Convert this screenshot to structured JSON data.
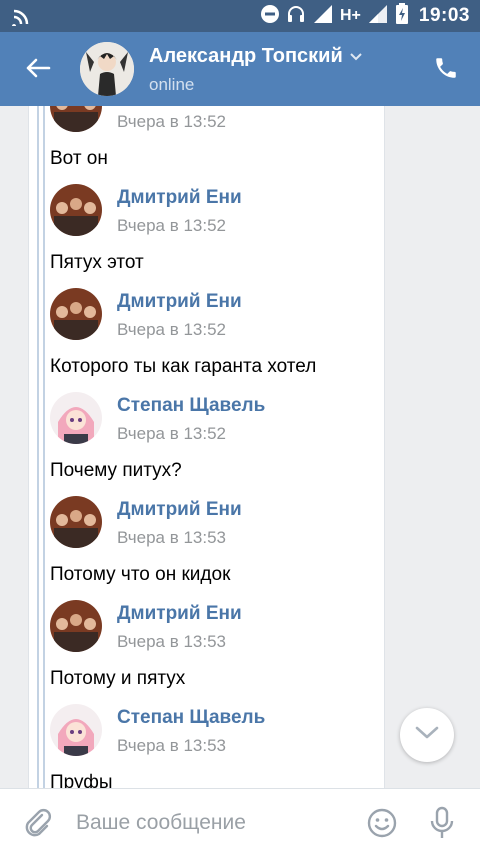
{
  "status_bar": {
    "network": "H+",
    "time": "19:03",
    "icons": [
      "cast-icon",
      "dnd-icon",
      "headphones-icon",
      "signal-icon",
      "signal-icon-2",
      "battery-charging-icon"
    ]
  },
  "header": {
    "back_icon": "arrow-back-icon",
    "contact_name": "Александр Топский",
    "status": "online",
    "call_icon": "phone-icon"
  },
  "messages": [
    {
      "author": "",
      "time": "Вчера в 13:52",
      "text": "Вот он",
      "avatar": "group-photo"
    },
    {
      "author": "Дмитрий Ени",
      "time": "Вчера в 13:52",
      "text": "Пятух этот",
      "avatar": "group-photo"
    },
    {
      "author": "Дмитрий Ени",
      "time": "Вчера в 13:52",
      "text": "Которого ты как гаранта хотел",
      "avatar": "group-photo"
    },
    {
      "author": "Степан Щавель",
      "time": "Вчера в 13:52",
      "text": "Почему питух?",
      "avatar": "anime"
    },
    {
      "author": "Дмитрий Ени",
      "time": "Вчера в 13:53",
      "text": "Потому что он кидок",
      "avatar": "group-photo"
    },
    {
      "author": "Дмитрий Ени",
      "time": "Вчера в 13:53",
      "text": "Потому и пятух",
      "avatar": "group-photo"
    },
    {
      "author": "Степан Щавель",
      "time": "Вчера в 13:53",
      "text": "Пруфы",
      "avatar": "anime"
    }
  ],
  "composer": {
    "placeholder": "Ваше сообщение",
    "value": ""
  },
  "colors": {
    "status_bar": "#3f5f84",
    "header": "#5181b8",
    "name_link": "#4a76a8",
    "background": "#edeef0"
  }
}
